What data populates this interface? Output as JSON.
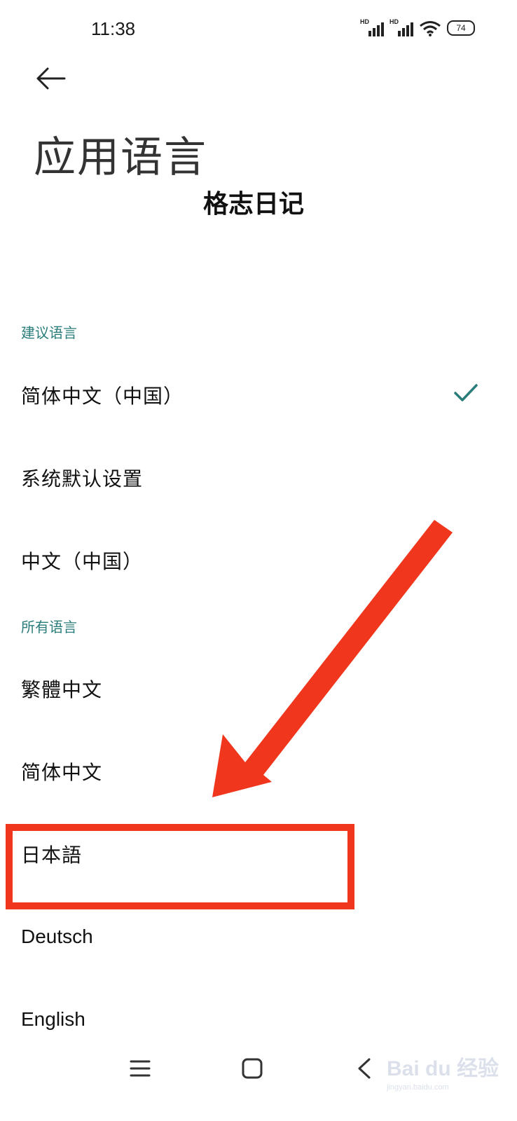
{
  "status_bar": {
    "time": "11:38",
    "signal_1_label": "HD",
    "signal_2_label": "HD",
    "battery": "74"
  },
  "header": {
    "title": "应用语言",
    "app_name": "格志日记"
  },
  "suggested": {
    "header": "建议语言",
    "items": [
      {
        "label": "简体中文（中国）",
        "selected": true
      },
      {
        "label": "系统默认设置",
        "selected": false
      },
      {
        "label": "中文（中国）",
        "selected": false
      }
    ]
  },
  "all": {
    "header": "所有语言",
    "items": [
      {
        "label": "繁體中文"
      },
      {
        "label": "简体中文"
      },
      {
        "label": "日本語"
      },
      {
        "label": "Deutsch"
      },
      {
        "label": "English"
      }
    ]
  },
  "colors": {
    "accent": "#2a7d7a",
    "annotation": "#f0361c"
  },
  "watermark": {
    "main": "Bai du 经验",
    "sub": "jingyan.baidu.com"
  }
}
